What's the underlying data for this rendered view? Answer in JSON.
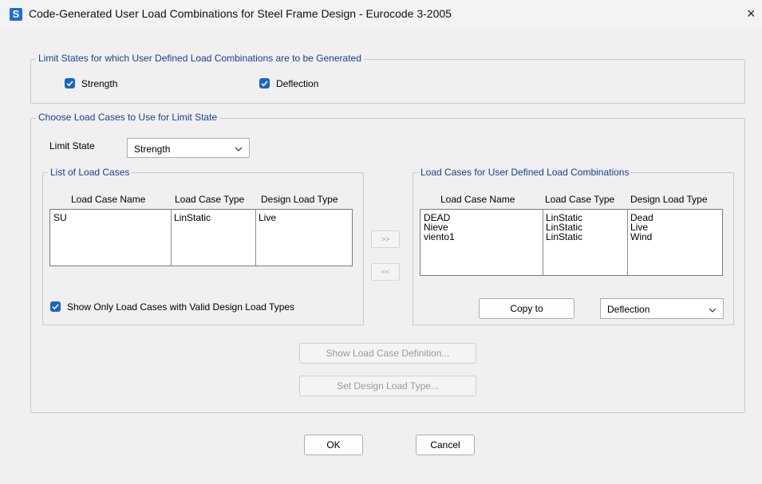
{
  "window": {
    "app_icon": "S",
    "title": "Code-Generated User Load Combinations for Steel Frame Design - Eurocode 3-2005",
    "close": "×"
  },
  "limit_states": {
    "legend": "Limit States for which User Defined Load Combinations are to be Generated",
    "strength": {
      "label": "Strength",
      "checked": true
    },
    "deflection": {
      "label": "Deflection",
      "checked": true
    }
  },
  "choose": {
    "legend": "Choose Load Cases to Use for Limit State",
    "limit_state_label": "Limit State",
    "limit_state_value": "Strength",
    "list": {
      "legend": "List of Load Cases",
      "headers": [
        "Load Case Name",
        "Load Case Type",
        "Design Load Type"
      ],
      "rows": [
        [
          "SU",
          "LinStatic",
          "Live"
        ]
      ],
      "show_only_label": "Show Only Load Cases with Valid Design Load Types"
    },
    "move_right": ">>",
    "move_left": "<<",
    "user": {
      "legend": "Load Cases for User Defined Load Combinations",
      "headers": [
        "Load Case Name",
        "Load Case Type",
        "Design Load Type"
      ],
      "rows": [
        [
          "DEAD",
          "LinStatic",
          "Dead"
        ],
        [
          "Nieve",
          "LinStatic",
          "Live"
        ],
        [
          "viento1",
          "LinStatic",
          "Wind"
        ]
      ],
      "copy_to": "Copy to",
      "copy_target": "Deflection"
    },
    "show_definition": "Show Load Case Definition...",
    "set_design_type": "Set Design Load Type..."
  },
  "footer": {
    "ok": "OK",
    "cancel": "Cancel"
  },
  "colors": {
    "checkbox": "#1a64c8",
    "legend_text": "#1a3f8f"
  }
}
